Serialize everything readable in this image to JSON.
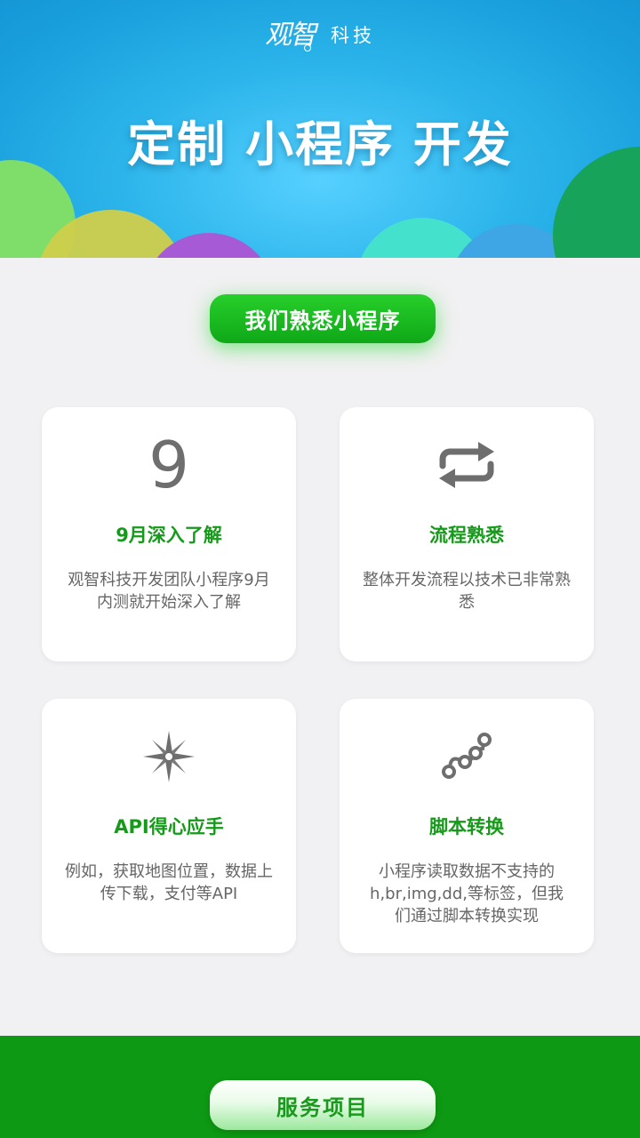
{
  "header": {
    "logo_mark": "观智",
    "logo_text": "科技",
    "hero_title": "定制 小程序 开发"
  },
  "intro": {
    "pill_label": "我们熟悉小程序"
  },
  "features": [
    {
      "icon": "nine-numeral-icon",
      "icon_text": "9",
      "title": "9月深入了解",
      "desc": "观智科技开发团队小程序9月内测就开始深入了解"
    },
    {
      "icon": "repeat-arrows-icon",
      "title": "流程熟悉",
      "desc": "整体开发流程以技术已非常熟悉"
    },
    {
      "icon": "compass-star-icon",
      "title": "API得心应手",
      "desc": "例如，获取地图位置，数据上传下载，支付等API"
    },
    {
      "icon": "connected-nodes-icon",
      "title": "脚本转换",
      "desc": "小程序读取数据不支持的h,br,img,dd,等标签，但我们通过脚本转换实现"
    }
  ],
  "footer": {
    "service_label": "服务项目"
  },
  "colors": {
    "hero_blue": "#1aa0dd",
    "accent_green": "#159a19",
    "footer_green": "#0d9913",
    "page_bg": "#f1f0f2"
  }
}
